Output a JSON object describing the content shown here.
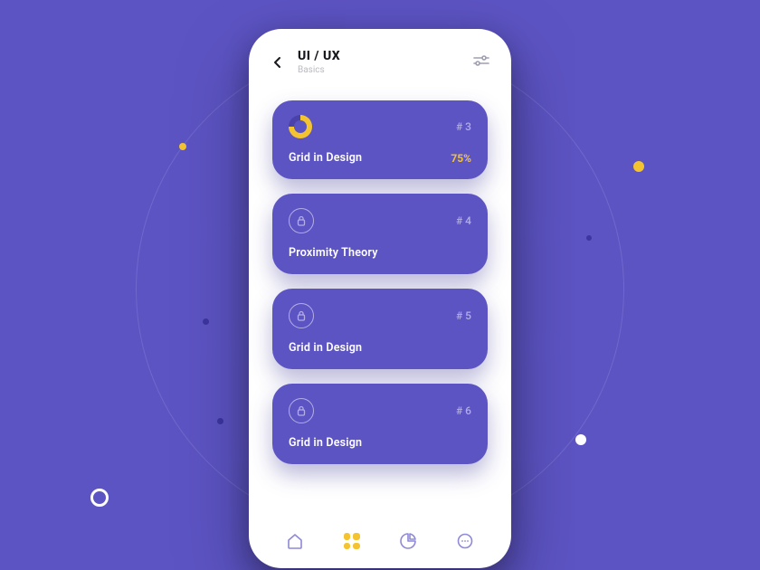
{
  "header": {
    "title": "UI / UX",
    "subtitle": "Basics"
  },
  "lessons": [
    {
      "index": "# 3",
      "title": "Grid in Design",
      "progress": "75%",
      "locked": false
    },
    {
      "index": "# 4",
      "title": "Proximity Theory",
      "progress": "",
      "locked": true
    },
    {
      "index": "# 5",
      "title": "Grid in Design",
      "progress": "",
      "locked": true
    },
    {
      "index": "# 6",
      "title": "Grid in Design",
      "progress": "",
      "locked": true
    }
  ],
  "colors": {
    "bg": "#5d54c4",
    "accent": "#f4c430",
    "muted": "#b3aee6"
  }
}
